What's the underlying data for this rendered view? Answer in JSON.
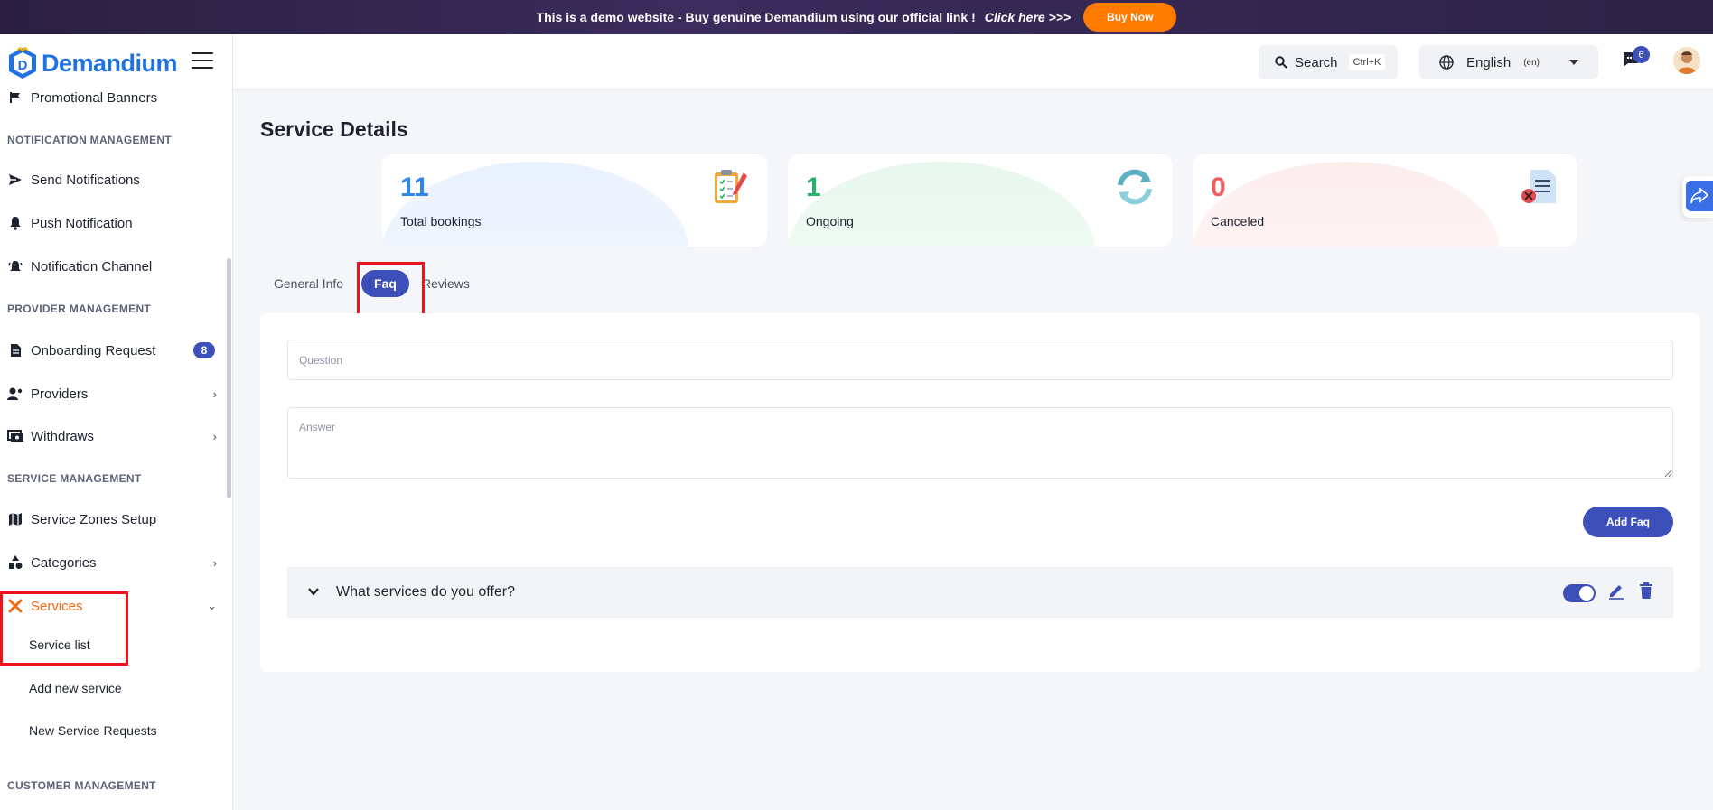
{
  "promo": {
    "text": "This is a demo website - Buy genuine Demandium using our official link !",
    "link": "Click here >>>",
    "button": "Buy Now"
  },
  "brand": {
    "name": "Demandium"
  },
  "sidebar": {
    "promotional_banners": "Promotional Banners",
    "sections": {
      "notification": "NOTIFICATION MANAGEMENT",
      "provider": "PROVIDER MANAGEMENT",
      "service": "SERVICE MANAGEMENT",
      "customer": "CUSTOMER MANAGEMENT"
    },
    "send_notifications": "Send Notifications",
    "push_notification": "Push Notification",
    "notification_channel": "Notification Channel",
    "onboarding_request": "Onboarding Request",
    "onboarding_count": "8",
    "providers": "Providers",
    "withdraws": "Withdraws",
    "service_zones": "Service Zones Setup",
    "categories": "Categories",
    "services": "Services",
    "service_list": "Service list",
    "add_new_service": "Add new service",
    "new_service_requests": "New Service Requests"
  },
  "header": {
    "search_label": "Search",
    "search_shortcut": "Ctrl+K",
    "language": "English",
    "language_code": "(en)",
    "message_count": "6"
  },
  "page": {
    "title": "Service Details",
    "stats": [
      {
        "value": "11",
        "label": "Total bookings",
        "color": "#2f86e8"
      },
      {
        "value": "1",
        "label": "Ongoing",
        "color": "#27b36a"
      },
      {
        "value": "0",
        "label": "Canceled",
        "color": "#f25d5d"
      }
    ],
    "tabs": {
      "general_info": "General Info",
      "faq": "Faq",
      "reviews": "Reviews"
    },
    "form": {
      "question_placeholder": "Question",
      "answer_placeholder": "Answer",
      "add_button": "Add Faq"
    },
    "faqs": [
      {
        "question": "What services do you offer?",
        "active": true
      }
    ]
  },
  "colors": {
    "primary": "#3d4fb8",
    "accent_orange": "#f06a13",
    "highlight_red": "#e8141b",
    "brand_blue": "#1e73e0"
  }
}
